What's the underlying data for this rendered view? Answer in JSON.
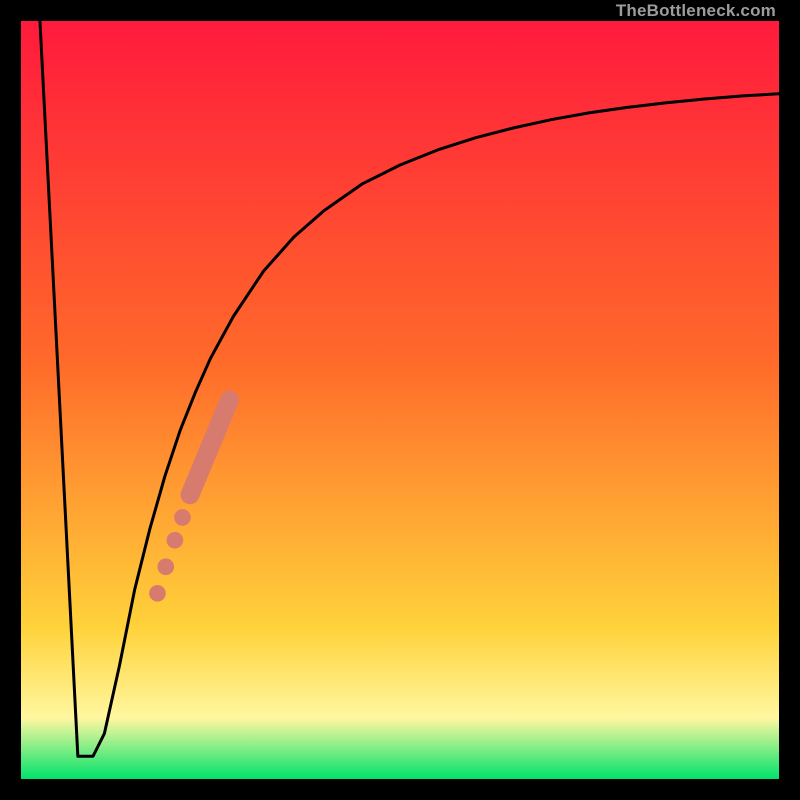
{
  "watermark": "TheBottleneck.com",
  "colors": {
    "frame": "#000000",
    "watermark_text": "#9c9c9c",
    "gradient_top": "#ff1a3c",
    "gradient_mid1": "#ff6a2a",
    "gradient_mid2": "#ffd23a",
    "gradient_band": "#fff7a0",
    "gradient_green": "#00e36b",
    "curve": "#000000",
    "dots": "#d77b6f"
  },
  "chart_data": {
    "type": "line",
    "title": "",
    "xlabel": "",
    "ylabel": "",
    "xlim": [
      0,
      100
    ],
    "ylim": [
      0,
      100
    ],
    "series": [
      {
        "name": "bottleneck-curve",
        "x": [
          2.5,
          7.5,
          9.5,
          11.0,
          13.0,
          15.0,
          17.0,
          19.0,
          21.0,
          23.0,
          25.0,
          28.0,
          32.0,
          36.0,
          40.0,
          45.0,
          50.0,
          55.0,
          60.0,
          65.0,
          70.0,
          75.0,
          80.0,
          85.0,
          90.0,
          95.0,
          100.0
        ],
        "y": [
          100,
          3.0,
          3.0,
          6.0,
          15.0,
          25.0,
          33.0,
          40.0,
          46.0,
          51.0,
          55.5,
          61.0,
          67.0,
          71.5,
          75.0,
          78.5,
          81.0,
          83.0,
          84.6,
          85.9,
          87.0,
          87.9,
          88.6,
          89.2,
          89.7,
          90.1,
          90.4
        ]
      }
    ],
    "dots": {
      "name": "highlight-dots",
      "points": [
        {
          "x": 18.0,
          "y": 24.5,
          "r": 1.1
        },
        {
          "x": 19.1,
          "y": 28.0,
          "r": 1.1
        },
        {
          "x": 20.3,
          "y": 31.5,
          "r": 1.1
        },
        {
          "x": 21.3,
          "y": 34.5,
          "r": 1.1
        }
      ],
      "bar": {
        "x1": 22.3,
        "y1": 37.5,
        "x2": 27.5,
        "y2": 50.0,
        "thickness": 2.5
      }
    }
  }
}
